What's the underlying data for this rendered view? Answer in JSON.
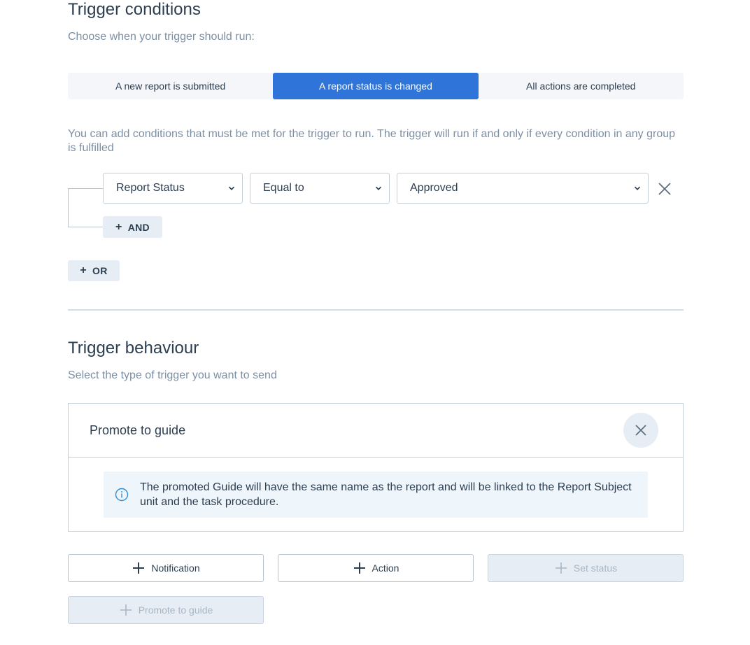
{
  "conditions": {
    "title": "Trigger conditions",
    "subtitle": "Choose when your trigger should run:",
    "tabs": [
      {
        "label": "A new report is submitted",
        "active": false
      },
      {
        "label": "A report status is changed",
        "active": true
      },
      {
        "label": "All actions are completed",
        "active": false
      }
    ],
    "description": "You can add conditions that must be met for the trigger to run. The trigger will run if and only if every condition in any group is fulfilled",
    "rule": {
      "field": "Report Status",
      "operator": "Equal to",
      "value": "Approved"
    },
    "and_label": "AND",
    "or_label": "OR"
  },
  "behaviour": {
    "title": "Trigger behaviour",
    "subtitle": "Select the type of trigger you want to send",
    "card": {
      "title": "Promote to guide",
      "info": "The promoted Guide will have the same name as the report and will be linked to the Report Subject unit and the task procedure."
    },
    "buttons": {
      "notification": "Notification",
      "action": "Action",
      "set_status": "Set status",
      "promote": "Promote to guide"
    }
  },
  "colors": {
    "accent": "#2f74d8",
    "muted_text": "#7d8fa3",
    "info_bg": "#eef5fb"
  },
  "icons": [
    "chevron-down-icon",
    "close-icon",
    "info-icon",
    "plus-icon"
  ]
}
